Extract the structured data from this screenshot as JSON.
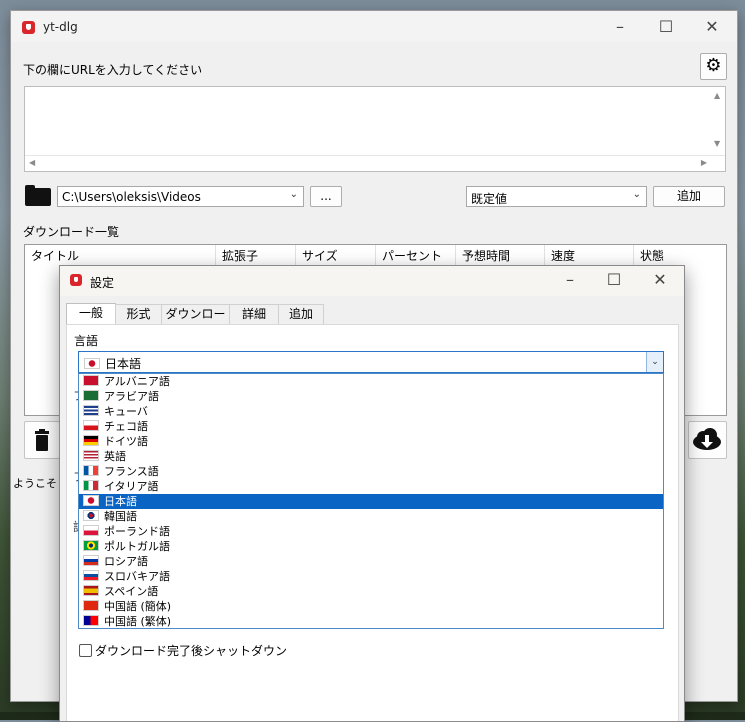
{
  "main": {
    "title": "yt-dlg",
    "url_prompt": "下の欄にURLを入力してください",
    "path_value": "C:\\Users\\oleksis\\Videos",
    "browse_label": "...",
    "format_value": "既定値",
    "add_label": "追加",
    "list_title": "ダウンロード一覧",
    "columns": [
      "タイトル",
      "拡張子",
      "サイズ",
      "パーセント",
      "予想時間",
      "速度",
      "状態"
    ],
    "status": "ようこそ"
  },
  "dialog": {
    "title": "設定",
    "tabs": [
      "一般",
      "形式",
      "ダウンロード",
      "詳細",
      "追加"
    ],
    "language_label": "言語",
    "language_value": "日本語",
    "languages": [
      {
        "label": "アルバニア語",
        "flag": "al"
      },
      {
        "label": "アラビア語",
        "flag": "sa"
      },
      {
        "label": "キューバ",
        "flag": "cu"
      },
      {
        "label": "チェコ語",
        "flag": "cz"
      },
      {
        "label": "ドイツ語",
        "flag": "de"
      },
      {
        "label": "英語",
        "flag": "us"
      },
      {
        "label": "フランス語",
        "flag": "fr"
      },
      {
        "label": "イタリア語",
        "flag": "it"
      },
      {
        "label": "日本語",
        "flag": "jp"
      },
      {
        "label": "韓国語",
        "flag": "kr"
      },
      {
        "label": "ポーランド語",
        "flag": "pl"
      },
      {
        "label": "ポルトガル語",
        "flag": "br"
      },
      {
        "label": "ロシア語",
        "flag": "ru"
      },
      {
        "label": "スロバキア語",
        "flag": "sk"
      },
      {
        "label": "スペイン語",
        "flag": "es"
      },
      {
        "label": "中国語 (簡体)",
        "flag": "cn"
      },
      {
        "label": "中国語 (繁体)",
        "flag": "tw"
      }
    ],
    "selected_language": "日本語",
    "shutdown_label": "ダウンロード完了後シャットダウン",
    "partial_labels": [
      "フ",
      "フ",
      "認"
    ]
  },
  "colors": {
    "accent": "#0a64c4",
    "app_icon": "#d9262c"
  }
}
